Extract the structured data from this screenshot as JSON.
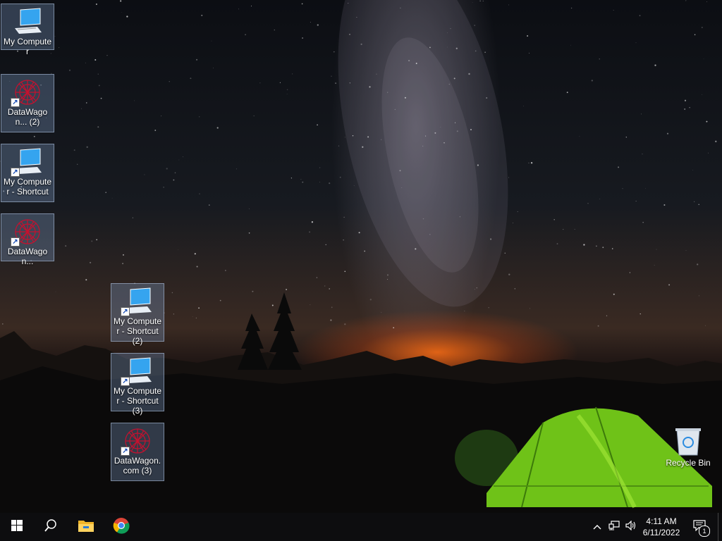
{
  "desktop": {
    "icons": [
      {
        "label": "My Computer",
        "icon": "monitor-icon",
        "shortcut": false
      },
      {
        "label": "DataWagon... (2)",
        "icon": "datawagon-logo-icon",
        "shortcut": true
      },
      {
        "label": "My Computer - Shortcut",
        "icon": "monitor-icon",
        "shortcut": true
      },
      {
        "label": "DataWagon...",
        "icon": "datawagon-logo-icon",
        "shortcut": true
      },
      {
        "label": "My Computer - Shortcut (2)",
        "icon": "monitor-icon",
        "shortcut": true
      },
      {
        "label": "My Computer - Shortcut (3)",
        "icon": "monitor-icon",
        "shortcut": true
      },
      {
        "label": "DataWagon.com (3)",
        "icon": "datawagon-logo-icon",
        "shortcut": true
      }
    ],
    "recycle_bin": {
      "label": "Recycle Bin",
      "icon": "recycle-bin-icon"
    }
  },
  "taskbar": {
    "start": {
      "icon": "windows-logo-icon"
    },
    "search": {
      "icon": "search-icon"
    },
    "pinned": [
      {
        "icon": "file-explorer-icon"
      },
      {
        "icon": "chrome-icon"
      }
    ],
    "tray": {
      "chevron": {
        "icon": "chevron-up-icon"
      },
      "network": {
        "icon": "network-icon"
      },
      "volume": {
        "icon": "volume-icon"
      },
      "time": "4:11 AM",
      "date": "6/11/2022",
      "notifications": {
        "icon": "notification-icon",
        "count": "1"
      }
    }
  },
  "colors": {
    "accent_tent": "#7bd11a",
    "glow": "#ff6a14",
    "taskbar": "#0d0d0f"
  }
}
